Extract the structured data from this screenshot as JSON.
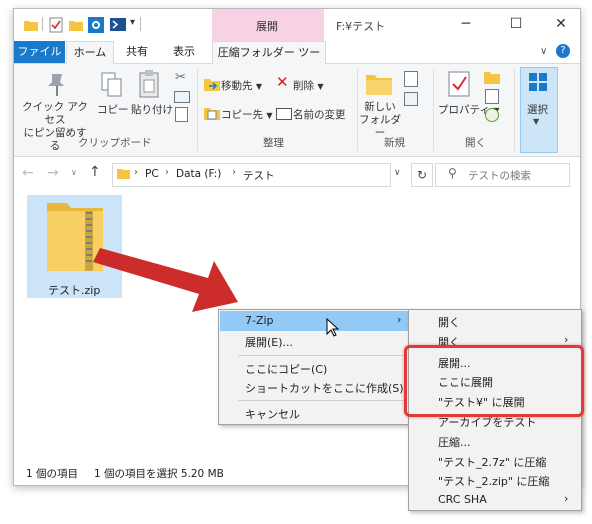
{
  "window": {
    "title": "F:¥テスト",
    "context_tab_header": "展開",
    "controls": [
      "─",
      "☐",
      "✕"
    ],
    "qa_toolbar_caret": "▾"
  },
  "tabs": {
    "file": "ファイル",
    "home": "ホーム",
    "share": "共有",
    "view": "表示",
    "extract_tools": "圧縮フォルダー ツール"
  },
  "ribbon": {
    "clipboard": {
      "pin_line1": "クイック アクセス",
      "pin_line2": "にピン留めする",
      "copy": "コピー",
      "paste": "貼り付け",
      "label": "クリップボード"
    },
    "organize": {
      "move_to": "移動先",
      "copy_to": "コピー先",
      "delete": "削除",
      "rename": "名前の変更",
      "label": "整理"
    },
    "new": {
      "folder_line1": "新しい",
      "folder_line2": "フォルダー",
      "label": "新規"
    },
    "open": {
      "properties": "プロパティ",
      "label": "開く"
    },
    "select": {
      "label": "選択"
    }
  },
  "address": {
    "crumbs": [
      "PC",
      "Data (F:)",
      "テスト"
    ],
    "search_placeholder": "テストの検索"
  },
  "file": {
    "name": "テスト.zip"
  },
  "status": {
    "items": "1 個の項目",
    "selection": "1 個の項目を選択  5.20 MB"
  },
  "context_menu": {
    "items": [
      {
        "label": "7-Zip",
        "submenu": true
      },
      {
        "label": "展開(E)..."
      },
      {
        "label": "ここにコピー(C)"
      },
      {
        "label": "ショートカットをここに作成(S)"
      },
      {
        "label": "キャンセル"
      }
    ]
  },
  "submenu": {
    "items": [
      {
        "label": "開く"
      },
      {
        "label": "開く",
        "submenu": true
      },
      {
        "label": "展開..."
      },
      {
        "label": "ここに展開"
      },
      {
        "label": "\"テスト¥\" に展開"
      },
      {
        "label": "アーカイブをテスト"
      },
      {
        "label": "圧縮..."
      },
      {
        "label": "\"テスト_2.7z\" に圧縮"
      },
      {
        "label": "\"テスト_2.zip\" に圧縮"
      },
      {
        "label": "CRC SHA",
        "submenu": true
      }
    ]
  },
  "colors": {
    "accent": "#1979ca",
    "context_tab": "#f7d2e4",
    "highlight_box": "#e03a3a",
    "arrow": "#c9211f",
    "menu_hover": "#91c9f7"
  }
}
